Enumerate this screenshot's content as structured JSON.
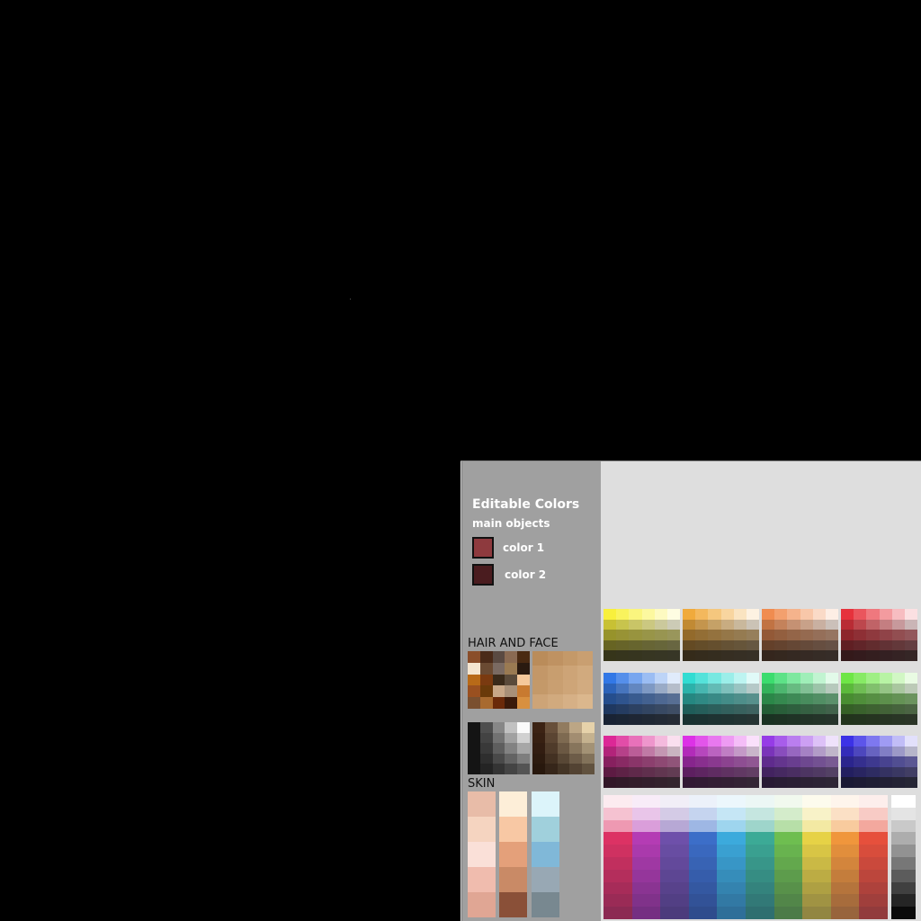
{
  "editable": {
    "title": "Editable Colors",
    "subtitle": "main objects",
    "colors": [
      {
        "label": "color 1",
        "value": "#8e3a3e"
      },
      {
        "label": "color 2",
        "value": "#4a1c1f"
      }
    ]
  },
  "hair_face": {
    "label": "HAIR AND FACE"
  },
  "skin": {
    "label": "SKIN"
  }
}
